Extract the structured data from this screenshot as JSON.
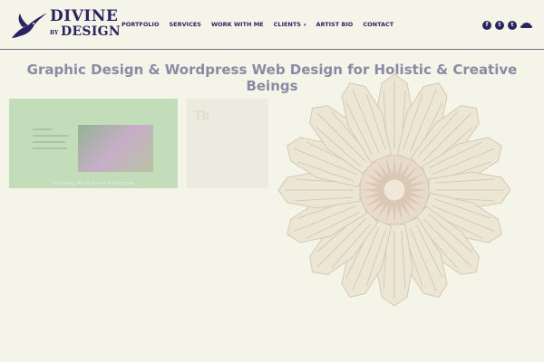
{
  "logo": {
    "word1": "DIVINE",
    "by": "BY",
    "word2": "DESIGN"
  },
  "nav": {
    "items": [
      {
        "label": "PORTFOLIO"
      },
      {
        "label": "SERVICES"
      },
      {
        "label": "WORK WITH ME"
      },
      {
        "label": "CLIENTS",
        "has_dropdown": true
      },
      {
        "label": "ARTIST BIO"
      },
      {
        "label": "CONTACT"
      }
    ],
    "dropdown_caret": "▾"
  },
  "social": {
    "icons": [
      {
        "name": "facebook-icon",
        "glyph": "f"
      },
      {
        "name": "twitter-icon",
        "glyph": "t"
      },
      {
        "name": "tumblr-icon",
        "glyph": "t"
      },
      {
        "name": "soundcloud-icon",
        "glyph": ""
      }
    ]
  },
  "main": {
    "tagline": "Graphic Design & Wordpress Web Design for Holistic & Creative Beings"
  },
  "portfolio": {
    "cards": [
      {
        "caption": "Visioning Art & Event Production"
      },
      {
        "title": "Th"
      }
    ]
  },
  "colors": {
    "brand": "#2c2461",
    "background": "#f5f4e9",
    "tagline": "#8a8aa4"
  }
}
